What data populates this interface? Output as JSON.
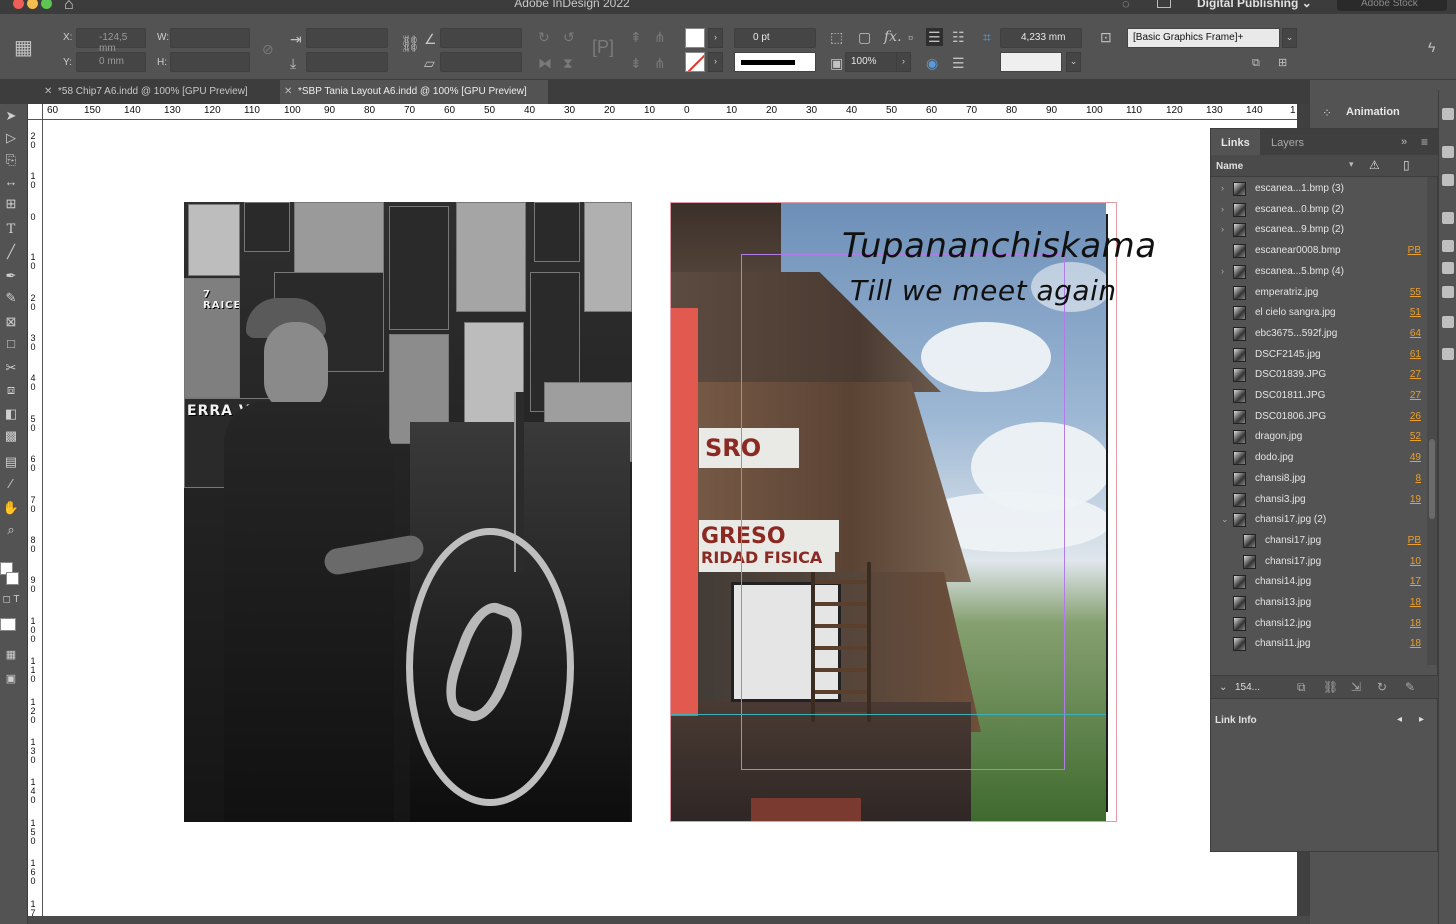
{
  "app": {
    "title": "Adobe InDesign 2022",
    "workspace": "Digital Publishing",
    "stock_search_placeholder": "Adobe Stock"
  },
  "control": {
    "x_label": "X:",
    "x_value": "-124,5 mm",
    "y_label": "Y:",
    "y_value": "0 mm",
    "w_label": "W:",
    "h_label": "H:",
    "stroke_weight": "0 pt",
    "scale": "100%",
    "fitting_value": "4,233 mm",
    "object_style": "[Basic Graphics Frame]+",
    "fx_label": "fx."
  },
  "tabs": [
    {
      "label": "*58 Chip7 A6.indd @ 100% [GPU Preview]"
    },
    {
      "label": "*SBP Tania Layout A6.indd @ 100% [GPU Preview]"
    }
  ],
  "ruler": {
    "h": [
      "60",
      "150",
      "140",
      "130",
      "120",
      "110",
      "100",
      "90",
      "80",
      "70",
      "60",
      "50",
      "40",
      "30",
      "20",
      "10",
      "0",
      "10",
      "20",
      "30",
      "40",
      "50",
      "60",
      "70",
      "80",
      "90",
      "100",
      "110",
      "120",
      "130",
      "140",
      "1"
    ],
    "v": [
      "20",
      "10",
      "0",
      "10",
      "20",
      "30",
      "40",
      "50",
      "60",
      "70",
      "80",
      "90",
      "100",
      "110",
      "120",
      "130",
      "140",
      "150",
      "160",
      "170"
    ]
  },
  "page_right": {
    "headline": "Tupananchiskama",
    "subline": "Till we meet again",
    "sign1": "SRO",
    "sign2": "GRESO",
    "sign3": "RIDAD FISICA"
  },
  "page_left": {
    "poster1": "7 RAICES",
    "poster2": "ERRA VIDA"
  },
  "panel": {
    "animation_tab": "Animation",
    "tab_links": "Links",
    "tab_layers": "Layers",
    "col_name": "Name",
    "links": [
      {
        "name": "escanea...1.bmp (3)",
        "page": "",
        "expand": "›"
      },
      {
        "name": "escanea...0.bmp (2)",
        "page": "",
        "expand": "›"
      },
      {
        "name": "escanea...9.bmp (2)",
        "page": "",
        "expand": "›"
      },
      {
        "name": "escanear0008.bmp",
        "page": "PB",
        "expand": ""
      },
      {
        "name": "escanea...5.bmp (4)",
        "page": "",
        "expand": "›"
      },
      {
        "name": "emperatriz.jpg",
        "page": "55",
        "expand": ""
      },
      {
        "name": "el cielo sangra.jpg",
        "page": "51",
        "expand": ""
      },
      {
        "name": "ebc3675...592f.jpg",
        "page": "64",
        "expand": ""
      },
      {
        "name": "DSCF2145.jpg",
        "page": "61",
        "expand": ""
      },
      {
        "name": "DSC01839.JPG",
        "page": "27",
        "expand": ""
      },
      {
        "name": "DSC01811.JPG",
        "page": "27",
        "expand": ""
      },
      {
        "name": "DSC01806.JPG",
        "page": "26",
        "expand": ""
      },
      {
        "name": "dragon.jpg",
        "page": "52",
        "expand": ""
      },
      {
        "name": "dodo.jpg",
        "page": "49",
        "expand": ""
      },
      {
        "name": "chansi8.jpg",
        "page": "8",
        "expand": ""
      },
      {
        "name": "chansi3.jpg",
        "page": "19",
        "expand": ""
      },
      {
        "name": "chansi17.jpg (2)",
        "page": "",
        "expand": "⌄"
      },
      {
        "name": "chansi17.jpg",
        "page": "PB",
        "expand": "",
        "indent": true
      },
      {
        "name": "chansi17.jpg",
        "page": "10",
        "expand": "",
        "indent": true
      },
      {
        "name": "chansi14.jpg",
        "page": "17",
        "expand": ""
      },
      {
        "name": "chansi13.jpg",
        "page": "18",
        "expand": ""
      },
      {
        "name": "chansi12.jpg",
        "page": "18",
        "expand": ""
      },
      {
        "name": "chansi11.jpg",
        "page": "18",
        "expand": ""
      }
    ],
    "count": "154...",
    "link_info": "Link Info"
  },
  "colors": {
    "accent_red": "#e2594f",
    "page_number": "#e9a02e"
  }
}
